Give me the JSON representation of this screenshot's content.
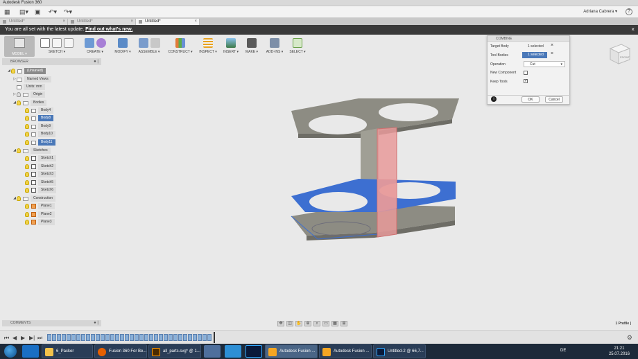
{
  "window": {
    "title": "Autodesk Fusion 360"
  },
  "qat": {
    "user": "Adriana Cabrera ▾"
  },
  "doc_tabs": [
    {
      "label": "Untitled*"
    },
    {
      "label": "Untitled*"
    },
    {
      "label": "Untitled*"
    }
  ],
  "notification": {
    "text": "You are all set with the latest update.",
    "link": "Find out what's new."
  },
  "ribbon": {
    "model": "MODEL ▾",
    "groups": [
      "SKETCH ▾",
      "CREATE ▾",
      "MODIFY ▾",
      "ASSEMBLE ▾",
      "CONSTRUCT ▾",
      "INSPECT ▾",
      "INSERT ▾",
      "MAKE ▾",
      "ADD-INS ▾",
      "SELECT ▾"
    ]
  },
  "browser": {
    "title": "BROWSER",
    "root": "(Unsaved)",
    "named_views": "Named Views",
    "units": "Units: mm",
    "origin": "Origin",
    "bodies": "Bodies",
    "body_items": [
      "Body4",
      "Body8",
      "Body9",
      "Body10",
      "Body11"
    ],
    "sketches": "Sketches",
    "sketch_items": [
      "Sketch1",
      "Sketch2",
      "Sketch3",
      "Sketch5",
      "Sketch6"
    ],
    "construction": "Construction",
    "plane_items": [
      "Plane1",
      "Plane2",
      "Plane3"
    ]
  },
  "comments": {
    "title": "COMMENTS"
  },
  "combine": {
    "title": "COMBINE",
    "target_body_label": "Target Body",
    "target_body_value": "1 selected",
    "tool_bodies_label": "Tool Bodies",
    "tool_bodies_value": "1 selected",
    "operation_label": "Operation",
    "operation_value": "Cut",
    "new_component_label": "New Component",
    "keep_tools_label": "Keep Tools",
    "ok": "OK",
    "cancel": "Cancel"
  },
  "viewcube": {
    "face": "FRONT"
  },
  "status": {
    "profile": "1 Profile |"
  },
  "taskbar": {
    "items": [
      "6_Packer",
      "Fusion 360 For Be...",
      "all_parts.svg* @ 1...",
      "Autodesk Fusion ...",
      "Autodesk Fusion ...",
      "Untitled-2 @ 66,7..."
    ],
    "lang": "DE",
    "time": "21:21",
    "date": "25.07.2016"
  },
  "colors": {
    "selection": "#4a78b8",
    "blue_body": "#3d6fd1",
    "pink_body": "#e89a9a",
    "gray_body": "#8a8a80",
    "notify_bar": "#3a3a3a"
  }
}
